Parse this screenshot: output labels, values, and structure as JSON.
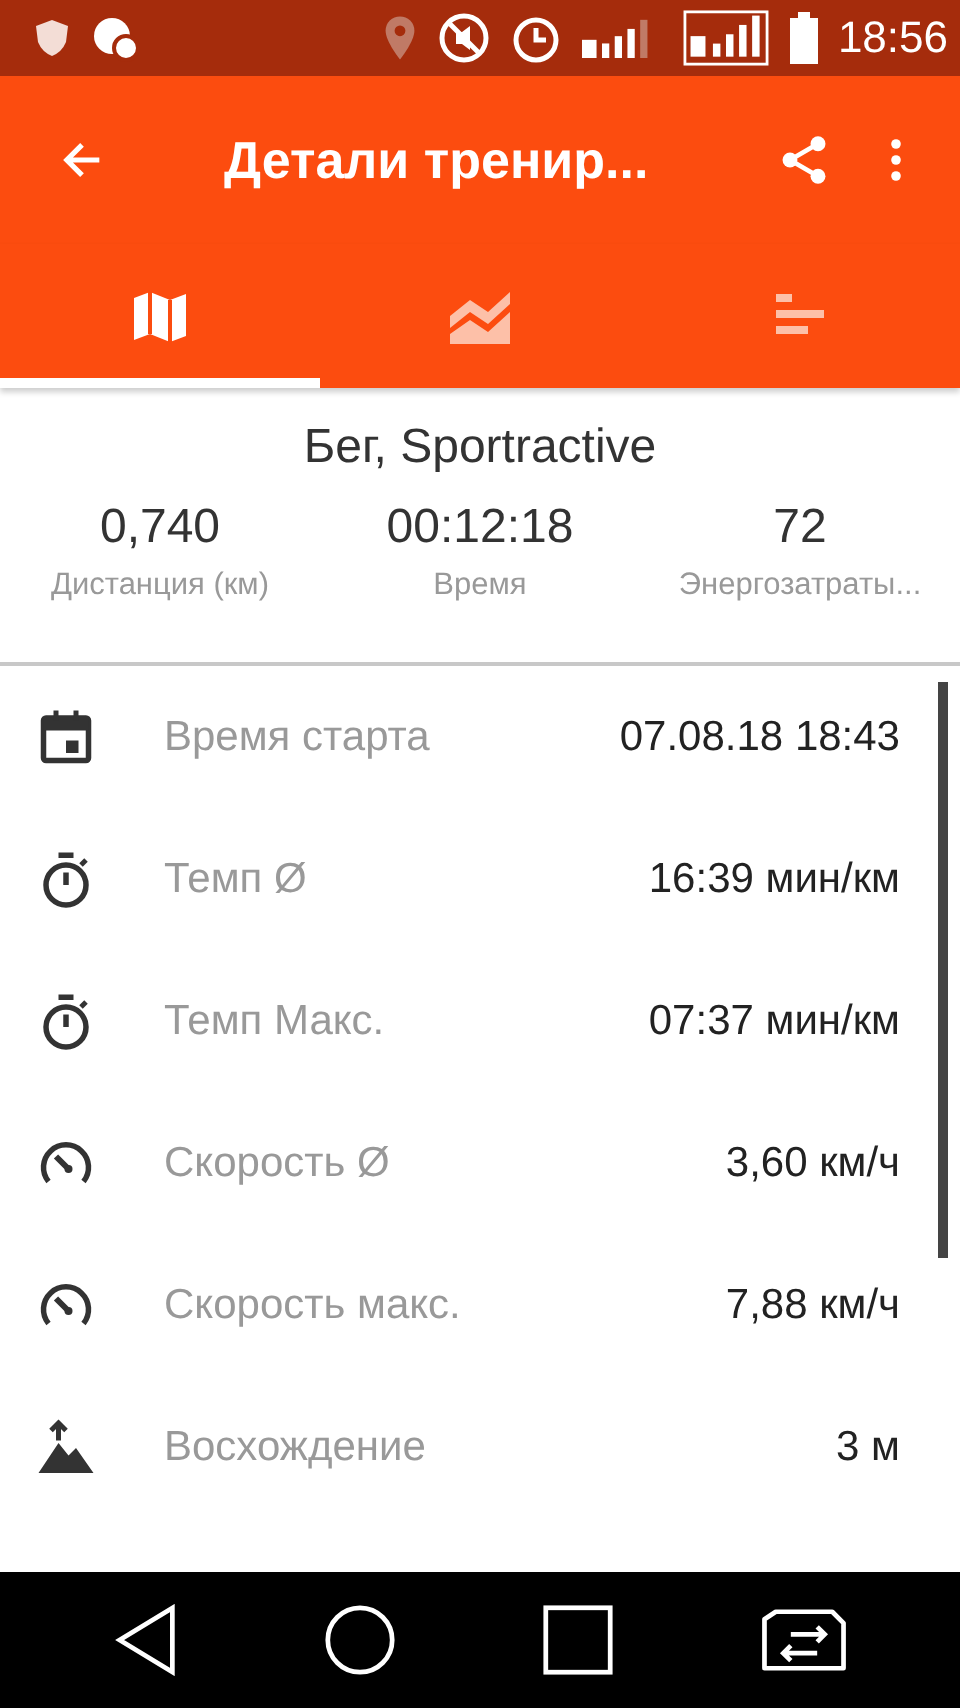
{
  "status_bar": {
    "time": "18:56"
  },
  "toolbar": {
    "title": "Детали тренир..."
  },
  "tabs": [
    {
      "kind": "map",
      "selected": true
    },
    {
      "kind": "chart",
      "selected": false
    },
    {
      "kind": "bars",
      "selected": false
    }
  ],
  "summary": {
    "title": "Бег, Sportractive",
    "stats": [
      {
        "value": "0,740",
        "label": "Дистанция (км)"
      },
      {
        "value": "00:12:18",
        "label": "Время"
      },
      {
        "value": "72",
        "label": "Энергозатраты..."
      }
    ]
  },
  "details": [
    {
      "kind": "calendar",
      "label": "Время старта",
      "value": "07.08.18 18:43"
    },
    {
      "kind": "stopwatch",
      "label": "Темп Ø",
      "value": "16:39 мин/км"
    },
    {
      "kind": "stopwatch",
      "label": "Темп Макс.",
      "value": "07:37 мин/км"
    },
    {
      "kind": "speedometer",
      "label": "Скорость Ø",
      "value": "3,60 км/ч"
    },
    {
      "kind": "speedometer",
      "label": "Скорость макс.",
      "value": "7,88 км/ч"
    },
    {
      "kind": "mountain",
      "label": "Восхождение",
      "value": "3 м"
    }
  ]
}
